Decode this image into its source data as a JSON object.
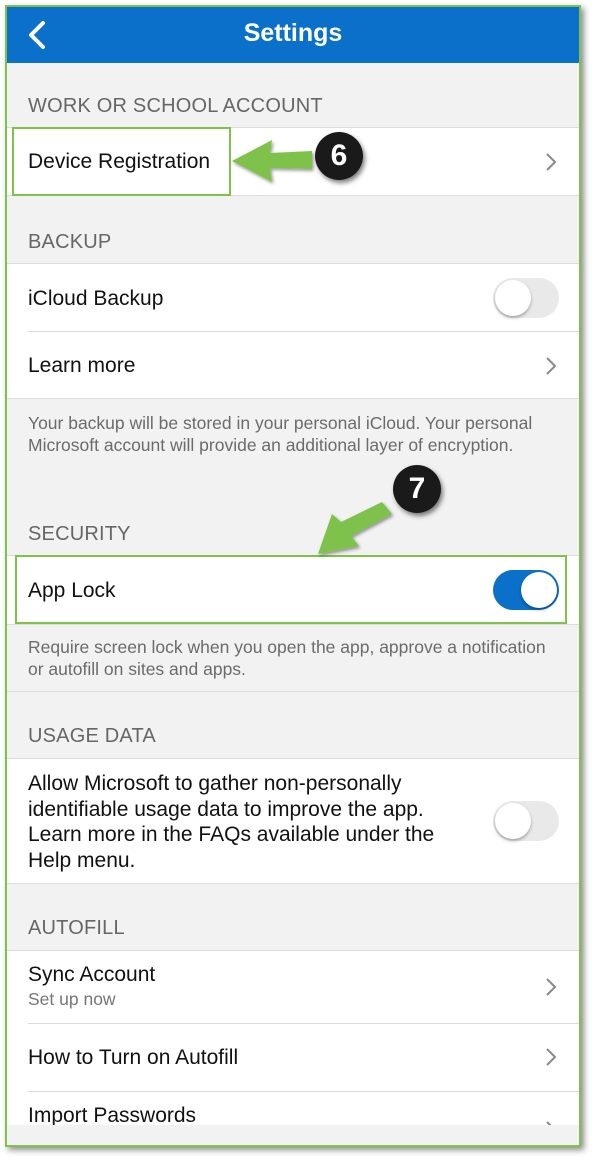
{
  "header": {
    "title": "Settings",
    "back_icon": "chevron-left-icon"
  },
  "sections": {
    "work": {
      "heading": "WORK OR SCHOOL ACCOUNT",
      "device_registration": "Device Registration"
    },
    "backup": {
      "heading": "BACKUP",
      "icloud_backup": "iCloud Backup",
      "icloud_backup_on": false,
      "learn_more": "Learn more",
      "note": "Your backup will be stored in your personal iCloud. Your personal Microsoft account will provide an additional layer of encryption."
    },
    "security": {
      "heading": "SECURITY",
      "app_lock": "App Lock",
      "app_lock_on": true,
      "note": "Require screen lock when you open the app, approve a notification or autofill on sites and apps."
    },
    "usage": {
      "heading": "USAGE DATA",
      "text": "Allow Microsoft to gather non-personally identifiable usage data to improve the app. Learn more in the FAQs available under the Help menu.",
      "usage_on": false
    },
    "autofill": {
      "heading": "AUTOFILL",
      "sync_account": "Sync Account",
      "sync_account_sub": "Set up now",
      "how_to": "How to Turn on Autofill",
      "import_passwords": "Import Passwords"
    }
  },
  "annotations": {
    "badge_6": "6",
    "badge_7": "7",
    "accent_color": "#7fc24b",
    "brand_color": "#0a70c9"
  }
}
